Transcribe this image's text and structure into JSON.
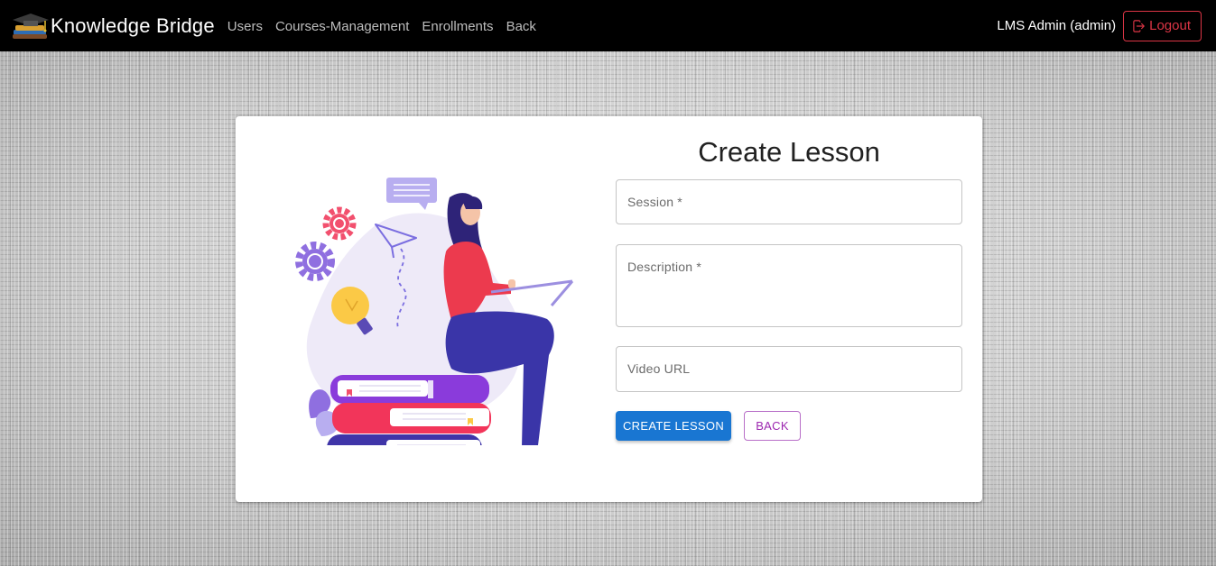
{
  "navbar": {
    "brand": "Knowledge Bridge",
    "links": [
      "Users",
      "Courses-Management",
      "Enrollments",
      "Back"
    ],
    "user": "LMS Admin (admin)",
    "logout_label": "Logout"
  },
  "form": {
    "title": "Create Lesson",
    "session_label": "Session *",
    "description_label": "Description *",
    "video_label": "Video URL",
    "create_button": "CREATE LESSON",
    "back_button": "BACK"
  },
  "colors": {
    "navbar_bg": "#000000",
    "primary": "#1976d2",
    "secondary": "#9c27b0",
    "danger": "#dc3545"
  },
  "icons": {
    "brand": "graduation-cap-books-icon",
    "logout": "box-arrow-right-icon"
  }
}
